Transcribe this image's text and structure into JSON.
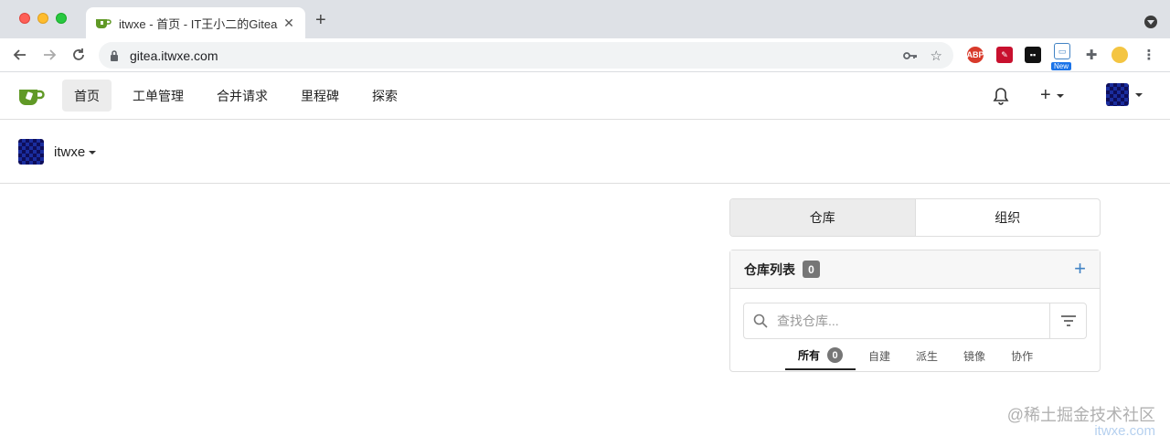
{
  "browser": {
    "tab_title": "itwxe - 首页 - IT王小二的Gitea",
    "tab_close": "✕",
    "new_tab": "+",
    "url": "gitea.itwxe.com",
    "ext_abp": "ABP",
    "ext_new_badge": "New"
  },
  "nav": {
    "home": "首页",
    "issues": "工单管理",
    "pulls": "合并请求",
    "milestones": "里程碑",
    "explore": "探索",
    "plus": "+"
  },
  "context": {
    "username": "itwxe"
  },
  "dashboard": {
    "tab_repos": "仓库",
    "tab_orgs": "组织",
    "repo_list_title": "仓库列表",
    "repo_count": "0",
    "add": "+",
    "search_placeholder": "查找仓库...",
    "filters": [
      {
        "label": "所有",
        "count": "0"
      },
      {
        "label": "自建"
      },
      {
        "label": "派生"
      },
      {
        "label": "镜像"
      },
      {
        "label": "协作"
      }
    ]
  },
  "watermark": {
    "line1": "@稀土掘金技术社区",
    "line2": "itwxe.com"
  },
  "colors": {
    "gitea_green": "#609926",
    "link_blue": "#4183c4",
    "badge_grey": "#767676"
  }
}
